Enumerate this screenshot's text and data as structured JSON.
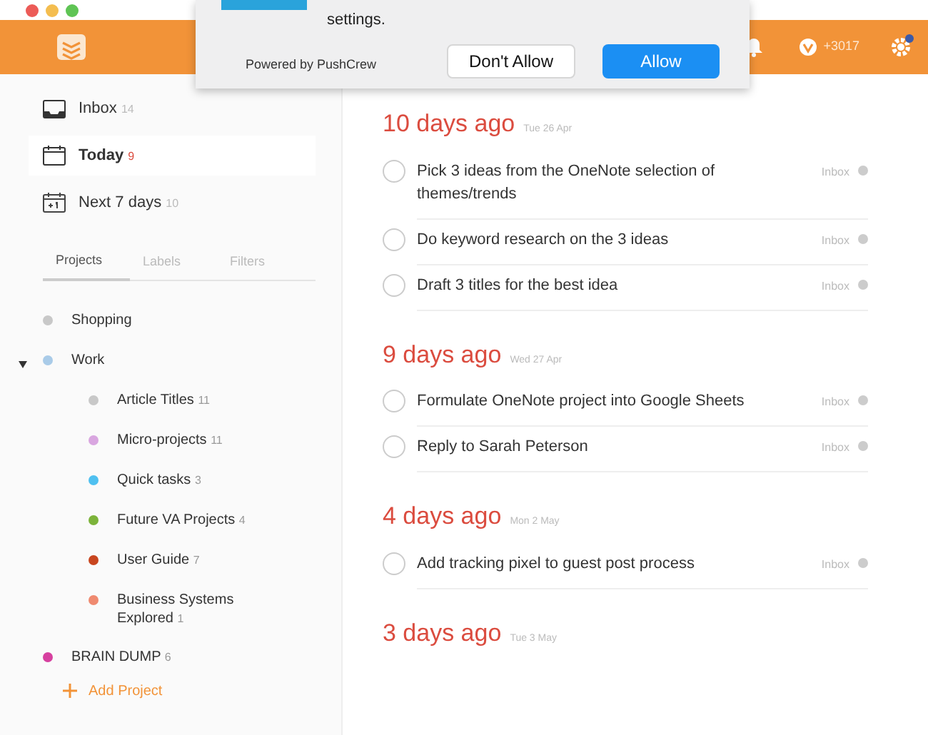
{
  "popup": {
    "message_tail": "settings.",
    "powered_by": "Powered by PushCrew",
    "buttons": [
      {
        "label": "Don't Allow",
        "primary": false
      },
      {
        "label": "Allow",
        "primary": true
      }
    ]
  },
  "header": {
    "karma": "+3017",
    "notification": true
  },
  "nav": [
    {
      "label": "Inbox",
      "count": "14",
      "selected": false
    },
    {
      "label": "Today",
      "count": "9",
      "selected": true
    },
    {
      "label": "Next 7 days",
      "count": "10",
      "selected": false
    }
  ],
  "tabs": [
    {
      "label": "Projects",
      "selected": true
    },
    {
      "label": "Labels",
      "selected": false
    },
    {
      "label": "Filters",
      "selected": false
    }
  ],
  "projects": [
    {
      "name": "Shopping",
      "color": "#c8c8c8"
    },
    {
      "name": "Work",
      "color": "#a9cbe8",
      "expanded": true,
      "children": [
        {
          "name": "Article Titles",
          "count": "11",
          "color": "#c8c8c8"
        },
        {
          "name": "Micro-projects",
          "count": "11",
          "color": "#d9a6e0"
        },
        {
          "name": "Quick tasks",
          "count": "3",
          "color": "#4fc0f0"
        },
        {
          "name": "Future VA Projects",
          "count": "4",
          "color": "#7cb33a"
        },
        {
          "name": "User Guide",
          "count": "7",
          "color": "#c8461f"
        },
        {
          "name": "Business Systems Explored",
          "count": "1",
          "color": "#ef8a70"
        }
      ]
    },
    {
      "name": "BRAIN DUMP",
      "count": "6",
      "color": "#d6409f"
    }
  ],
  "add_project": "Add Project",
  "sections": [
    {
      "title": "10 days ago",
      "date": "Tue 26 Apr",
      "tasks": [
        {
          "text": "Pick 3 ideas from the OneNote selection of themes/trends",
          "project": "Inbox",
          "checked": false
        },
        {
          "text": "Do keyword research on the 3 ideas",
          "project": "Inbox",
          "checked": false
        },
        {
          "text": "Draft 3 titles for the best idea",
          "project": "Inbox",
          "checked": false
        }
      ]
    },
    {
      "title": "9 days ago",
      "date": "Wed 27 Apr",
      "tasks": [
        {
          "text": "Formulate OneNote project into Google Sheets",
          "project": "Inbox",
          "checked": false
        },
        {
          "text": "Reply to Sarah Peterson",
          "project": "Inbox",
          "checked": false
        }
      ]
    },
    {
      "title": "4 days ago",
      "date": "Mon 2 May",
      "tasks": [
        {
          "text": "Add tracking pixel to guest post process",
          "project": "Inbox",
          "checked": false
        }
      ]
    },
    {
      "title": "3 days ago",
      "date": "Tue 3 May"
    }
  ]
}
